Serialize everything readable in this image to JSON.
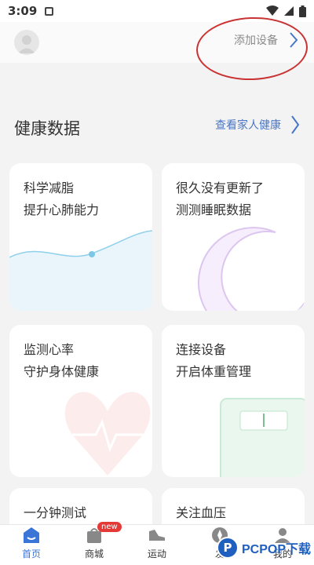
{
  "status": {
    "time": "3:09"
  },
  "header": {
    "add_device": "添加设备"
  },
  "health": {
    "title": "健康数据",
    "family_link": "查看家人健康"
  },
  "cards": [
    {
      "line1": "科学减脂",
      "line2": "提升心肺能力"
    },
    {
      "line1": "很久没有更新了",
      "line2": "测测睡眠数据"
    },
    {
      "line1": "监测心率",
      "line2": "守护身体健康"
    },
    {
      "line1": "连接设备",
      "line2": "开启体重管理"
    },
    {
      "line1": "一分钟测试"
    },
    {
      "line1": "关注血压"
    }
  ],
  "tabs": [
    {
      "label": "首页",
      "active": true
    },
    {
      "label": "商城",
      "badge": "new"
    },
    {
      "label": "运动"
    },
    {
      "label": "发"
    },
    {
      "label": "我的"
    }
  ],
  "watermark": {
    "logo": "P",
    "text": "PCPOP下载"
  },
  "colors": {
    "accent": "#3a76d8",
    "link": "#4a76c6",
    "highlight_ring": "#c93333",
    "badge": "#e53935"
  }
}
